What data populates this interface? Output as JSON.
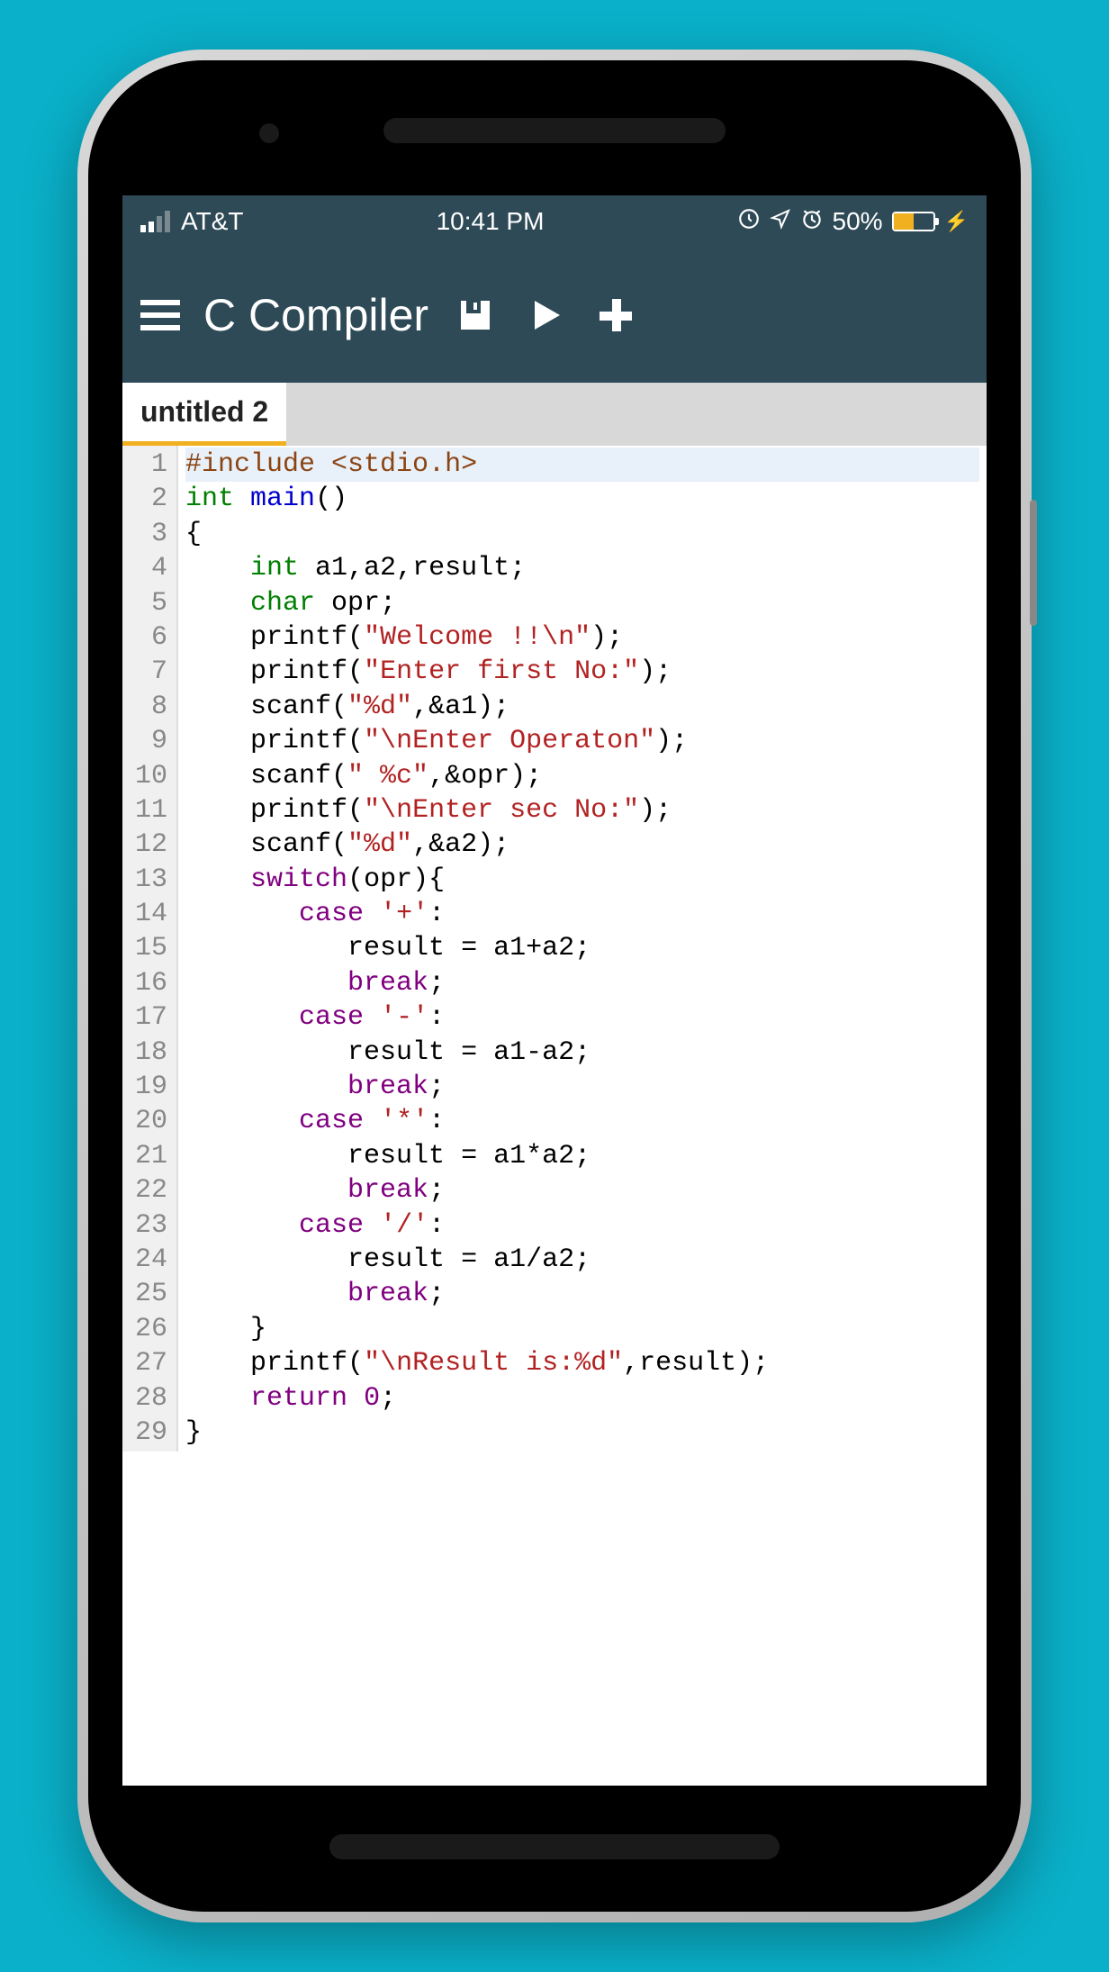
{
  "status": {
    "carrier": "AT&T",
    "time": "10:41 PM",
    "battery_pct": "50%"
  },
  "app": {
    "title": "C Compiler"
  },
  "tab": {
    "label": "untitled 2"
  },
  "code": {
    "lines": [
      {
        "n": "1",
        "tokens": [
          {
            "t": "#include <stdio.h>",
            "c": "kw-pp"
          }
        ]
      },
      {
        "n": "2",
        "tokens": [
          {
            "t": "int",
            "c": "kw-type"
          },
          {
            "t": " "
          },
          {
            "t": "main",
            "c": "kw-fn"
          },
          {
            "t": "()"
          }
        ]
      },
      {
        "n": "3",
        "tokens": [
          {
            "t": "{"
          }
        ]
      },
      {
        "n": "4",
        "tokens": [
          {
            "t": "    "
          },
          {
            "t": "int",
            "c": "kw-type"
          },
          {
            "t": " a1,a2,result;"
          }
        ]
      },
      {
        "n": "5",
        "tokens": [
          {
            "t": "    "
          },
          {
            "t": "char",
            "c": "kw-type"
          },
          {
            "t": " opr;"
          }
        ]
      },
      {
        "n": "6",
        "tokens": [
          {
            "t": "    printf("
          },
          {
            "t": "\"Welcome !!\\n\"",
            "c": "kw-str"
          },
          {
            "t": ");"
          }
        ]
      },
      {
        "n": "7",
        "tokens": [
          {
            "t": "    printf("
          },
          {
            "t": "\"Enter first No:\"",
            "c": "kw-str"
          },
          {
            "t": ");"
          }
        ]
      },
      {
        "n": "8",
        "tokens": [
          {
            "t": "    scanf("
          },
          {
            "t": "\"%d\"",
            "c": "kw-str"
          },
          {
            "t": ",&a1);"
          }
        ]
      },
      {
        "n": "9",
        "tokens": [
          {
            "t": "    printf("
          },
          {
            "t": "\"\\nEnter Operaton\"",
            "c": "kw-str"
          },
          {
            "t": ");"
          }
        ]
      },
      {
        "n": "10",
        "tokens": [
          {
            "t": "    scanf("
          },
          {
            "t": "\" %c\"",
            "c": "kw-str"
          },
          {
            "t": ",&opr);"
          }
        ]
      },
      {
        "n": "11",
        "tokens": [
          {
            "t": "    printf("
          },
          {
            "t": "\"\\nEnter sec No:\"",
            "c": "kw-str"
          },
          {
            "t": ");"
          }
        ]
      },
      {
        "n": "12",
        "tokens": [
          {
            "t": "    scanf("
          },
          {
            "t": "\"%d\"",
            "c": "kw-str"
          },
          {
            "t": ",&a2);"
          }
        ]
      },
      {
        "n": "13",
        "tokens": [
          {
            "t": "    "
          },
          {
            "t": "switch",
            "c": "kw-stmt"
          },
          {
            "t": "(opr){"
          }
        ]
      },
      {
        "n": "14",
        "tokens": [
          {
            "t": "       "
          },
          {
            "t": "case",
            "c": "kw-stmt"
          },
          {
            "t": " "
          },
          {
            "t": "'+'",
            "c": "kw-str"
          },
          {
            "t": ":"
          }
        ]
      },
      {
        "n": "15",
        "tokens": [
          {
            "t": "          result = a1+a2;"
          }
        ]
      },
      {
        "n": "16",
        "tokens": [
          {
            "t": "          "
          },
          {
            "t": "break",
            "c": "kw-stmt"
          },
          {
            "t": ";"
          }
        ]
      },
      {
        "n": "17",
        "tokens": [
          {
            "t": "       "
          },
          {
            "t": "case",
            "c": "kw-stmt"
          },
          {
            "t": " "
          },
          {
            "t": "'-'",
            "c": "kw-str"
          },
          {
            "t": ":"
          }
        ]
      },
      {
        "n": "18",
        "tokens": [
          {
            "t": "          result = a1-a2;"
          }
        ]
      },
      {
        "n": "19",
        "tokens": [
          {
            "t": "          "
          },
          {
            "t": "break",
            "c": "kw-stmt"
          },
          {
            "t": ";"
          }
        ]
      },
      {
        "n": "20",
        "tokens": [
          {
            "t": "       "
          },
          {
            "t": "case",
            "c": "kw-stmt"
          },
          {
            "t": " "
          },
          {
            "t": "'*'",
            "c": "kw-str"
          },
          {
            "t": ":"
          }
        ]
      },
      {
        "n": "21",
        "tokens": [
          {
            "t": "          result = a1*a2;"
          }
        ]
      },
      {
        "n": "22",
        "tokens": [
          {
            "t": "          "
          },
          {
            "t": "break",
            "c": "kw-stmt"
          },
          {
            "t": ";"
          }
        ]
      },
      {
        "n": "23",
        "tokens": [
          {
            "t": "       "
          },
          {
            "t": "case",
            "c": "kw-stmt"
          },
          {
            "t": " "
          },
          {
            "t": "'/'",
            "c": "kw-str"
          },
          {
            "t": ":"
          }
        ]
      },
      {
        "n": "24",
        "tokens": [
          {
            "t": "          result = a1/a2;"
          }
        ]
      },
      {
        "n": "25",
        "tokens": [
          {
            "t": "          "
          },
          {
            "t": "break",
            "c": "kw-stmt"
          },
          {
            "t": ";"
          }
        ]
      },
      {
        "n": "26",
        "tokens": [
          {
            "t": "    }"
          }
        ]
      },
      {
        "n": "27",
        "tokens": [
          {
            "t": "    printf("
          },
          {
            "t": "\"\\nResult is:%d\"",
            "c": "kw-str"
          },
          {
            "t": ",result);"
          }
        ]
      },
      {
        "n": "28",
        "tokens": [
          {
            "t": "    "
          },
          {
            "t": "return",
            "c": "kw-stmt"
          },
          {
            "t": " "
          },
          {
            "t": "0",
            "c": "kw-num"
          },
          {
            "t": ";"
          }
        ]
      },
      {
        "n": "29",
        "tokens": [
          {
            "t": "}"
          }
        ]
      }
    ]
  }
}
